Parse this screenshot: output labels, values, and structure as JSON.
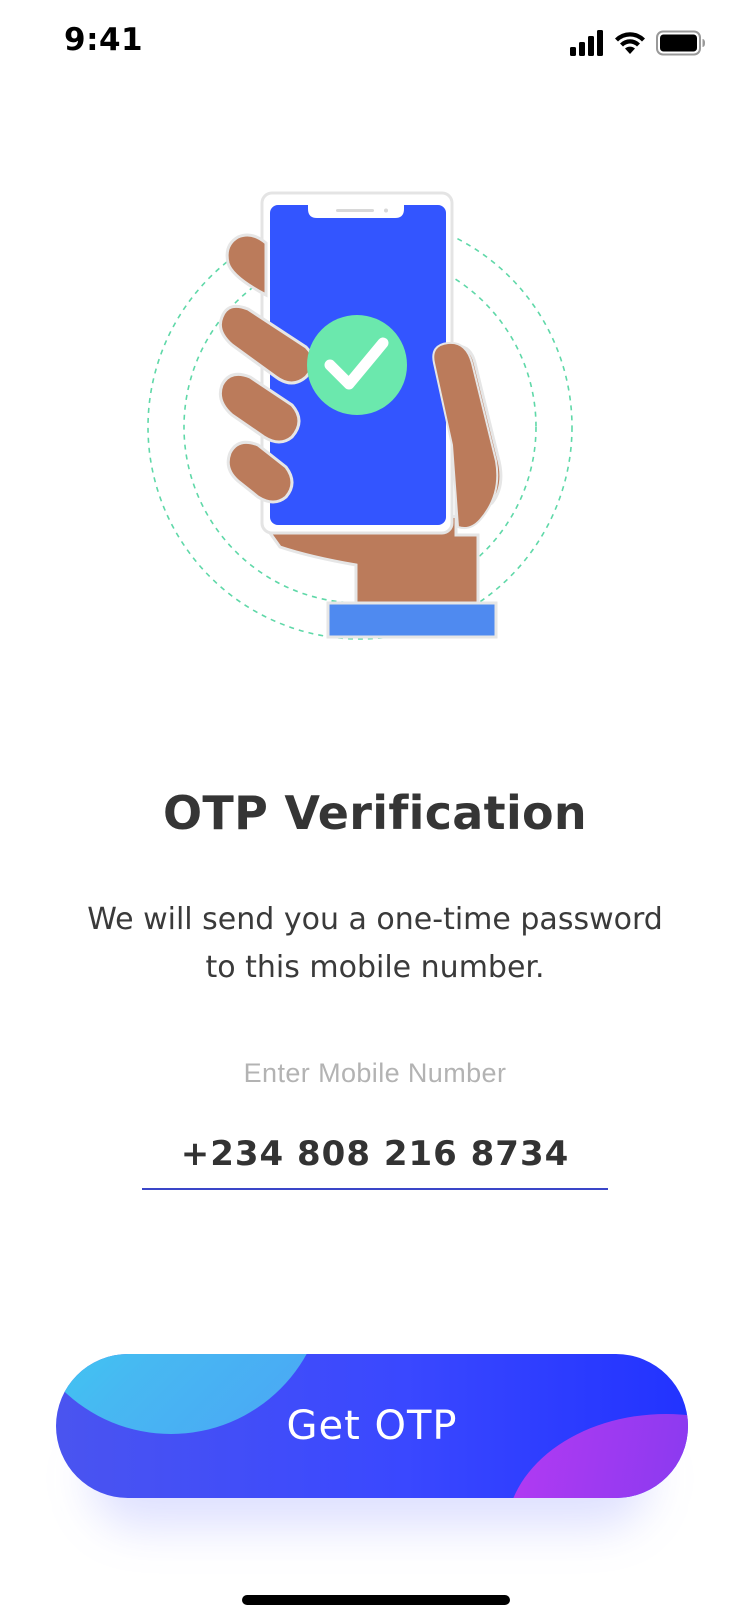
{
  "status_bar": {
    "time": "9:41"
  },
  "illustration": {
    "name": "hand holding phone with checkmark",
    "colors": {
      "screen": "#3355ff",
      "check": "#6be8ad",
      "skin": "#bb7b5b",
      "sleeve": "#4f8af0",
      "rings": "#5fd8a8"
    }
  },
  "page": {
    "title": "OTP Verification",
    "subtitle_line1": "We will send you a one-time password",
    "subtitle_line2": "to this mobile number."
  },
  "phone_input": {
    "label": "Enter Mobile Number",
    "value": "+234 808 216 8734",
    "underline_color": "#3a46c8"
  },
  "cta": {
    "label": "Get OTP"
  }
}
